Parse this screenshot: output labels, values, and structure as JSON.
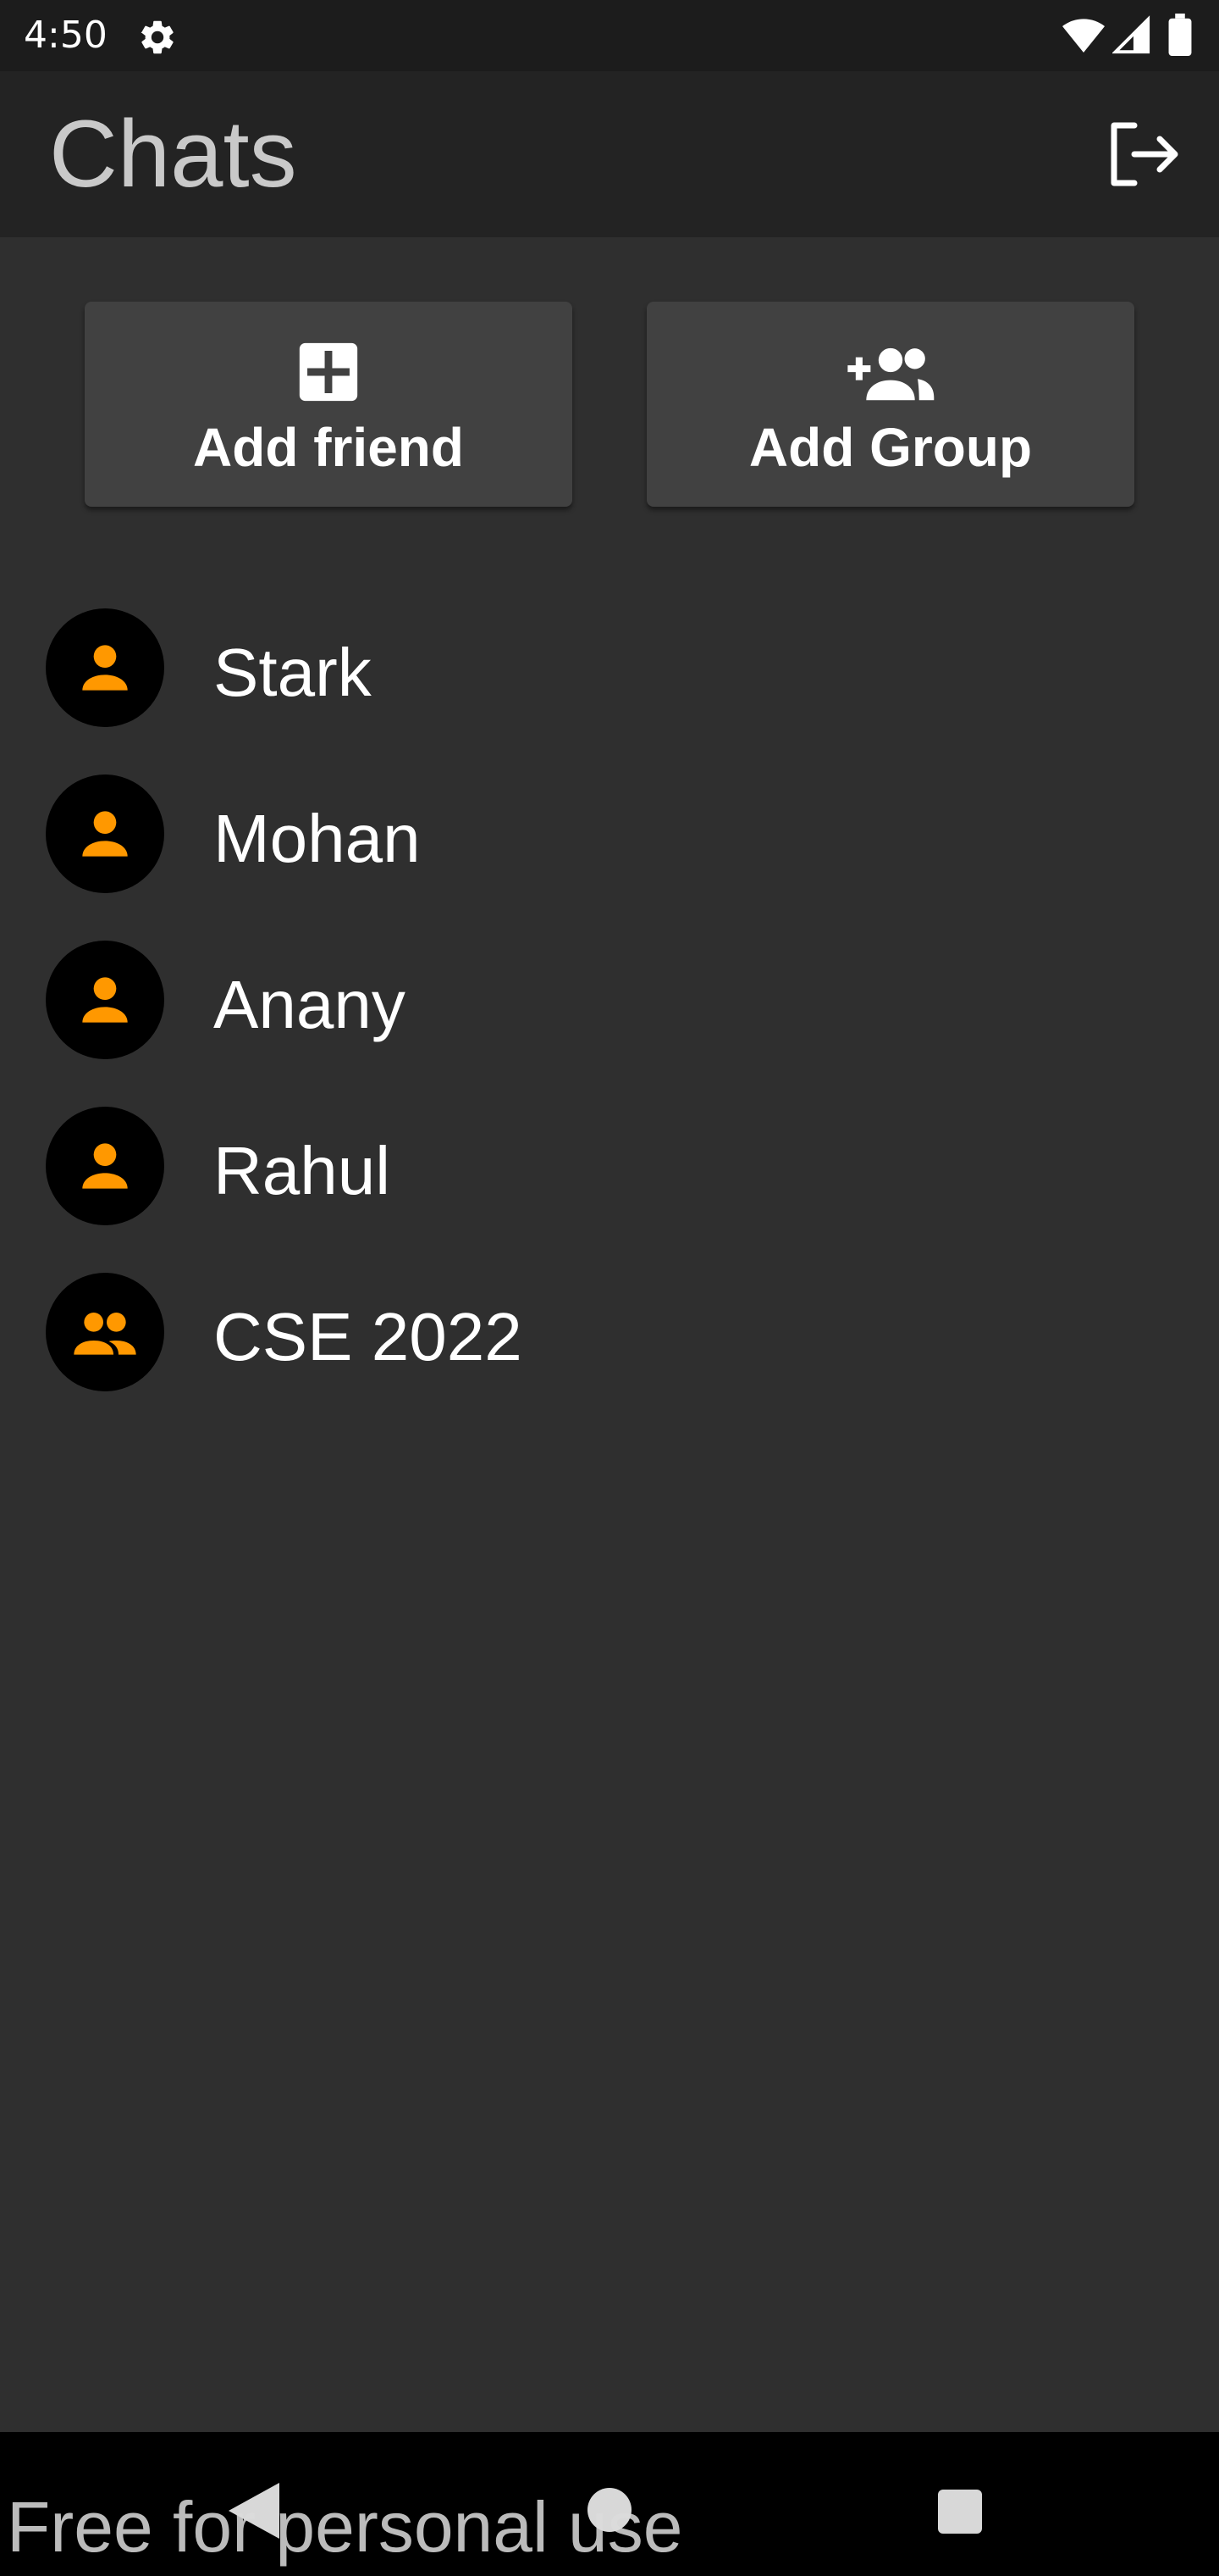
{
  "status_bar": {
    "time": "4:50",
    "icons": [
      "settings-icon",
      "wifi-icon",
      "signal-icon",
      "battery-icon"
    ]
  },
  "app_bar": {
    "title": "Chats",
    "action_icon": "logout-icon"
  },
  "actions": {
    "add_friend_label": "Add friend",
    "add_friend_icon": "add-box-icon",
    "add_group_label": "Add Group",
    "add_group_icon": "group-add-icon"
  },
  "chats": [
    {
      "name": "Stark",
      "avatar_icon": "person-icon"
    },
    {
      "name": "Mohan",
      "avatar_icon": "person-icon"
    },
    {
      "name": "Anany",
      "avatar_icon": "person-icon"
    },
    {
      "name": "Rahul",
      "avatar_icon": "person-icon"
    },
    {
      "name": "CSE 2022",
      "avatar_icon": "group-icon"
    }
  ],
  "nav_bar": {
    "icons": [
      "back-icon",
      "home-icon",
      "recents-icon"
    ]
  },
  "watermark": "Free for personal use",
  "colors": {
    "background": "#2f2f2f",
    "app_bar": "#232323",
    "status_bar": "#1c1c1c",
    "button": "#414141",
    "avatar_bg": "#000000",
    "accent": "#ff9800",
    "title": "#c9c9c9"
  }
}
